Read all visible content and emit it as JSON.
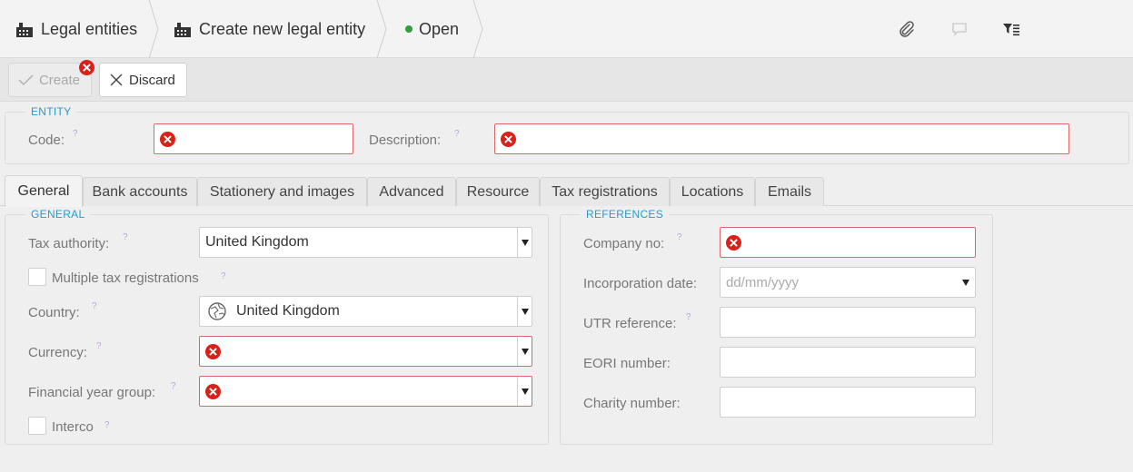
{
  "breadcrumb": {
    "items": [
      {
        "label": "Legal entities",
        "icon": "building-icon"
      },
      {
        "label": "Create new legal entity",
        "icon": "building-icon"
      },
      {
        "label": "Open",
        "icon": "status-dot-icon"
      }
    ]
  },
  "header_tools": [
    "paperclip-icon",
    "comment-icon",
    "filter-list-icon"
  ],
  "toolbar": {
    "create_label": "Create",
    "discard_label": "Discard"
  },
  "entity": {
    "legend": "ENTITY",
    "code_label": "Code:",
    "code_value": "",
    "description_label": "Description:",
    "description_value": ""
  },
  "tabs": [
    {
      "label": "General",
      "active": true
    },
    {
      "label": "Bank accounts"
    },
    {
      "label": "Stationery and images"
    },
    {
      "label": "Advanced"
    },
    {
      "label": "Resource"
    },
    {
      "label": "Tax registrations"
    },
    {
      "label": "Locations"
    },
    {
      "label": "Emails"
    }
  ],
  "general": {
    "legend": "GENERAL",
    "tax_authority_label": "Tax authority:",
    "tax_authority_value": "United Kingdom",
    "multiple_tax_label": "Multiple tax registrations",
    "country_label": "Country:",
    "country_value": "United Kingdom",
    "currency_label": "Currency:",
    "currency_value": "",
    "fy_group_label": "Financial year group:",
    "fy_group_value": "",
    "interco_label": "Interco"
  },
  "references": {
    "legend": "REFERENCES",
    "company_no_label": "Company no:",
    "company_no_value": "",
    "incorporation_label": "Incorporation date:",
    "incorporation_placeholder": "dd/mm/yyyy",
    "utr_label": "UTR reference:",
    "eori_label": "EORI number:",
    "charity_label": "Charity number:"
  },
  "help_mark": "?",
  "colors": {
    "accent": "#2b9ac9",
    "error": "#d9211c",
    "status_open": "#2e9e3e"
  }
}
